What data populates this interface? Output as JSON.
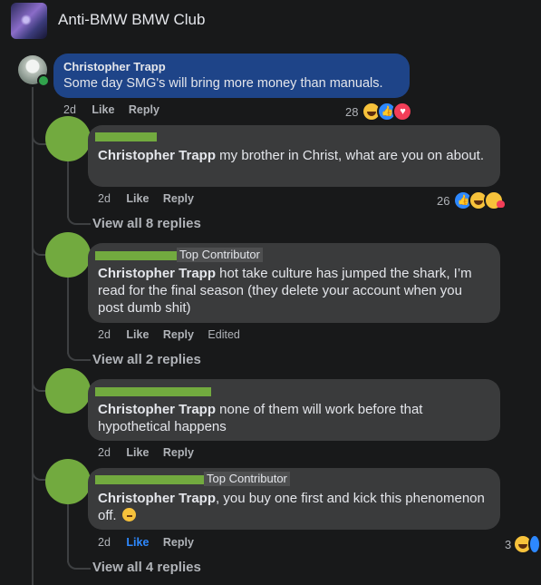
{
  "group": {
    "title": "Anti-BMW BMW Club"
  },
  "post_comment": {
    "author": "Christopher Trapp",
    "text": "Some day SMG's will bring more money than manuals.",
    "time": "2d",
    "like": "Like",
    "reply": "Reply",
    "reaction_count": "28",
    "reactions": [
      "haha-icon",
      "like-icon",
      "love-icon"
    ]
  },
  "replies": [
    {
      "mention": "Christopher Trapp",
      "text": " my brother in Christ, what are you on about.",
      "time": "2d",
      "like": "Like",
      "reply": "Reply",
      "reaction_count": "26",
      "reactions": [
        "like-icon",
        "haha-icon",
        "care-icon"
      ],
      "view_replies": "View all 8 replies"
    },
    {
      "badge": "Top Contributor",
      "mention": "Christopher Trapp",
      "text": " hot take culture has jumped the shark, I’m read for the final season (they delete your account when you post dumb shit)",
      "time": "2d",
      "like": "Like",
      "reply": "Reply",
      "edited": "Edited",
      "view_replies": "View all 2 replies"
    },
    {
      "mention": "Christopher Trapp",
      "text": " none of them will work before that hypothetical happens",
      "time": "2d",
      "like": "Like",
      "reply": "Reply"
    },
    {
      "badge": "Top Contributor",
      "mention": "Christopher Trapp",
      "text": ", you buy one first and kick this phenomenon off.",
      "time": "2d",
      "like": "Like",
      "reply": "Reply",
      "reaction_count": "3",
      "view_replies": "View all 4 replies"
    }
  ],
  "colors": {
    "background": "#18191a",
    "bubble": "#3a3b3c",
    "op_bubble": "#1e4488",
    "accent": "#2e89ff",
    "redaction": "#72aa3f"
  }
}
